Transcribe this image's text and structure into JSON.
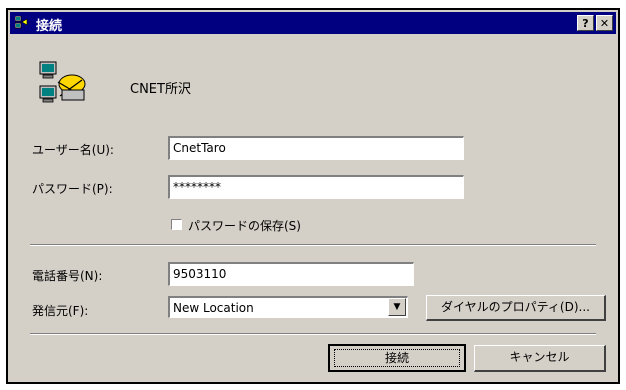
{
  "window": {
    "title": "接続",
    "help_label": "?",
    "close_label": "✕"
  },
  "connection": {
    "name": "CNET所沢",
    "icon": "dialup-connection-icon"
  },
  "form": {
    "username_label": "ユーザー名(U):",
    "username_value": "CnetTaro",
    "password_label": "パスワード(P):",
    "password_value": "********",
    "save_password_label": "パスワードの保存(S)",
    "save_password_checked": false,
    "phone_label": "電話番号(N):",
    "phone_value": "9503110",
    "dial_from_label": "発信元(F):",
    "dial_from_value": "New Location",
    "dial_properties_label": "ダイヤルのプロパティ(D)..."
  },
  "buttons": {
    "connect": "接続",
    "cancel": "キャンセル"
  },
  "colors": {
    "titlebar": "#000080",
    "dialog_bg": "#d4d0c8"
  }
}
